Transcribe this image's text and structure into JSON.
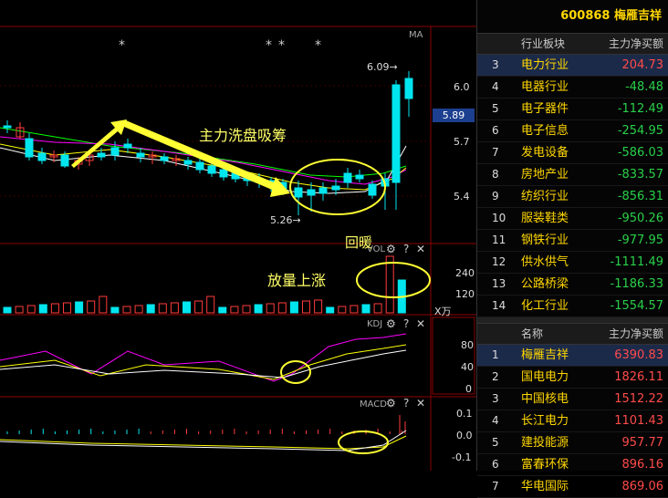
{
  "stock_title": "600868 梅雁吉祥",
  "chart": {
    "ma_label": "MA",
    "stars": [
      "*",
      "*",
      "*",
      "*"
    ],
    "high_price": "6.09",
    "low_price": "5.26",
    "current_price": "5.89",
    "price_axis": [
      "6.0",
      "5.7",
      "5.4"
    ],
    "vol_label": "VOL",
    "vol_axis": [
      "240",
      "120"
    ],
    "vol_unit": "X万",
    "kdj_label": "KDJ",
    "kdj_axis": [
      "80",
      "40",
      "0"
    ],
    "macd_label": "MACD",
    "macd_axis": [
      "0.1",
      "0.0",
      "-0.1"
    ],
    "gear_icon": "⚙",
    "help_icon": "?",
    "close_icon": "✕",
    "annotations": {
      "wash": "主力洗盘吸筹",
      "pullback": "回暖",
      "volume_up": "放量上涨"
    },
    "colors": {
      "up": "#ff3b3b",
      "down": "#00e5ee",
      "ma5": "#ffffff",
      "ma10": "#ffff00",
      "ma20": "#ff00ff",
      "ma60": "#00ff00",
      "annot": "#ffff66"
    }
  },
  "industry_table": {
    "headers": [
      "",
      "行业板块",
      "主力净买额"
    ],
    "rows": [
      {
        "no": "3",
        "name": "电力行业",
        "value": "204.73",
        "sign": "pos"
      },
      {
        "no": "4",
        "name": "电器行业",
        "value": "-48.48",
        "sign": "neg"
      },
      {
        "no": "5",
        "name": "电子器件",
        "value": "-112.49",
        "sign": "neg"
      },
      {
        "no": "6",
        "name": "电子信息",
        "value": "-254.95",
        "sign": "neg"
      },
      {
        "no": "7",
        "name": "发电设备",
        "value": "-586.03",
        "sign": "neg"
      },
      {
        "no": "8",
        "name": "房地产业",
        "value": "-833.57",
        "sign": "neg"
      },
      {
        "no": "9",
        "name": "纺织行业",
        "value": "-856.31",
        "sign": "neg"
      },
      {
        "no": "10",
        "name": "服装鞋类",
        "value": "-950.26",
        "sign": "neg"
      },
      {
        "no": "11",
        "name": "钢铁行业",
        "value": "-977.95",
        "sign": "neg"
      },
      {
        "no": "12",
        "name": "供水供气",
        "value": "-1111.49",
        "sign": "neg"
      },
      {
        "no": "13",
        "name": "公路桥梁",
        "value": "-1186.33",
        "sign": "neg"
      },
      {
        "no": "14",
        "name": "化工行业",
        "value": "-1554.57",
        "sign": "neg"
      }
    ]
  },
  "stock_table": {
    "headers": [
      "",
      "名称",
      "主力净买额"
    ],
    "rows": [
      {
        "no": "1",
        "name": "梅雁吉祥",
        "value": "6390.83",
        "sign": "pos"
      },
      {
        "no": "2",
        "name": "国电电力",
        "value": "1826.11",
        "sign": "pos"
      },
      {
        "no": "3",
        "name": "中国核电",
        "value": "1512.22",
        "sign": "pos"
      },
      {
        "no": "4",
        "name": "长江电力",
        "value": "1101.43",
        "sign": "pos"
      },
      {
        "no": "5",
        "name": "建投能源",
        "value": "957.77",
        "sign": "pos"
      },
      {
        "no": "6",
        "name": "富春环保",
        "value": "896.16",
        "sign": "pos"
      },
      {
        "no": "7",
        "name": "华电国际",
        "value": "869.06",
        "sign": "pos"
      }
    ]
  }
}
